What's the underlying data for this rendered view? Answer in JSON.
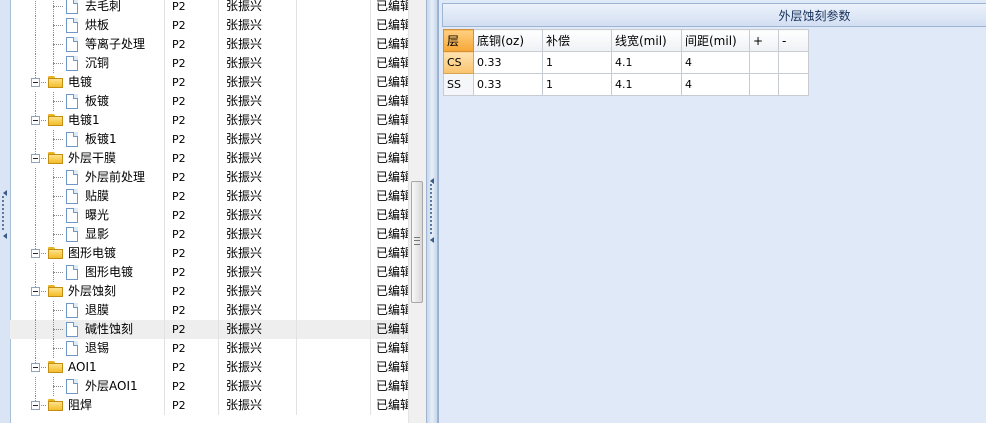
{
  "tree": {
    "rows": [
      {
        "type": "doc",
        "label": "去毛刺",
        "code": "P2",
        "person": "张振兴",
        "status": "已编辑"
      },
      {
        "type": "doc",
        "label": "烘板",
        "code": "P2",
        "person": "张振兴",
        "status": "已编辑"
      },
      {
        "type": "doc",
        "label": "等离子处理",
        "code": "P2",
        "person": "张振兴",
        "status": "已编辑"
      },
      {
        "type": "doc",
        "label": "沉铜",
        "code": "P2",
        "person": "张振兴",
        "status": "已编辑"
      },
      {
        "type": "folder",
        "label": "电镀",
        "code": "P2",
        "person": "张振兴",
        "status": "已编辑"
      },
      {
        "type": "doc",
        "label": "板镀",
        "code": "P2",
        "person": "张振兴",
        "status": "已编辑"
      },
      {
        "type": "folder",
        "label": "电镀1",
        "code": "P2",
        "person": "张振兴",
        "status": "已编辑"
      },
      {
        "type": "doc",
        "label": "板镀1",
        "code": "P2",
        "person": "张振兴",
        "status": "已编辑"
      },
      {
        "type": "folder",
        "label": "外层干膜",
        "code": "P2",
        "person": "张振兴",
        "status": "已编辑"
      },
      {
        "type": "doc",
        "label": "外层前处理",
        "code": "P2",
        "person": "张振兴",
        "status": "已编辑"
      },
      {
        "type": "doc",
        "label": "贴膜",
        "code": "P2",
        "person": "张振兴",
        "status": "已编辑"
      },
      {
        "type": "doc",
        "label": "曝光",
        "code": "P2",
        "person": "张振兴",
        "status": "已编辑"
      },
      {
        "type": "doc",
        "label": "显影",
        "code": "P2",
        "person": "张振兴",
        "status": "已编辑"
      },
      {
        "type": "folder",
        "label": "图形电镀",
        "code": "P2",
        "person": "张振兴",
        "status": "已编辑"
      },
      {
        "type": "doc",
        "label": "图形电镀",
        "code": "P2",
        "person": "张振兴",
        "status": "已编辑"
      },
      {
        "type": "folder",
        "label": "外层蚀刻",
        "code": "P2",
        "person": "张振兴",
        "status": "已编辑"
      },
      {
        "type": "doc",
        "label": "退膜",
        "code": "P2",
        "person": "张振兴",
        "status": "已编辑"
      },
      {
        "type": "doc",
        "label": "碱性蚀刻",
        "code": "P2",
        "person": "张振兴",
        "status": "已编辑",
        "selected": true
      },
      {
        "type": "doc",
        "label": "退锡",
        "code": "P2",
        "person": "张振兴",
        "status": "已编辑"
      },
      {
        "type": "folder",
        "label": "AOI1",
        "code": "P2",
        "person": "张振兴",
        "status": "已编辑"
      },
      {
        "type": "doc",
        "label": "外层AOI1",
        "code": "P2",
        "person": "张振兴",
        "status": "已编辑"
      },
      {
        "type": "folder",
        "label": "阻焊",
        "code": "P2",
        "person": "张振兴",
        "status": "已编辑"
      }
    ]
  },
  "right_panel": {
    "title": "外层蚀刻参数",
    "headers": [
      "层",
      "底铜(oz)",
      "补偿",
      "线宽(mil)",
      "间距(mil)",
      "+",
      "-"
    ],
    "rows": [
      {
        "layer": "CS",
        "base_copper": "0.33",
        "compensation": "1",
        "line_width": "4.1",
        "spacing": "4",
        "active": true
      },
      {
        "layer": "SS",
        "base_copper": "0.33",
        "compensation": "1",
        "line_width": "4.1",
        "spacing": "4",
        "active": false
      }
    ]
  },
  "colors": {
    "panel_bg": "#dfe9f8",
    "row_selected": "#eeeeee",
    "header_active": "#f7a735",
    "folder": "#f3bd2a"
  }
}
